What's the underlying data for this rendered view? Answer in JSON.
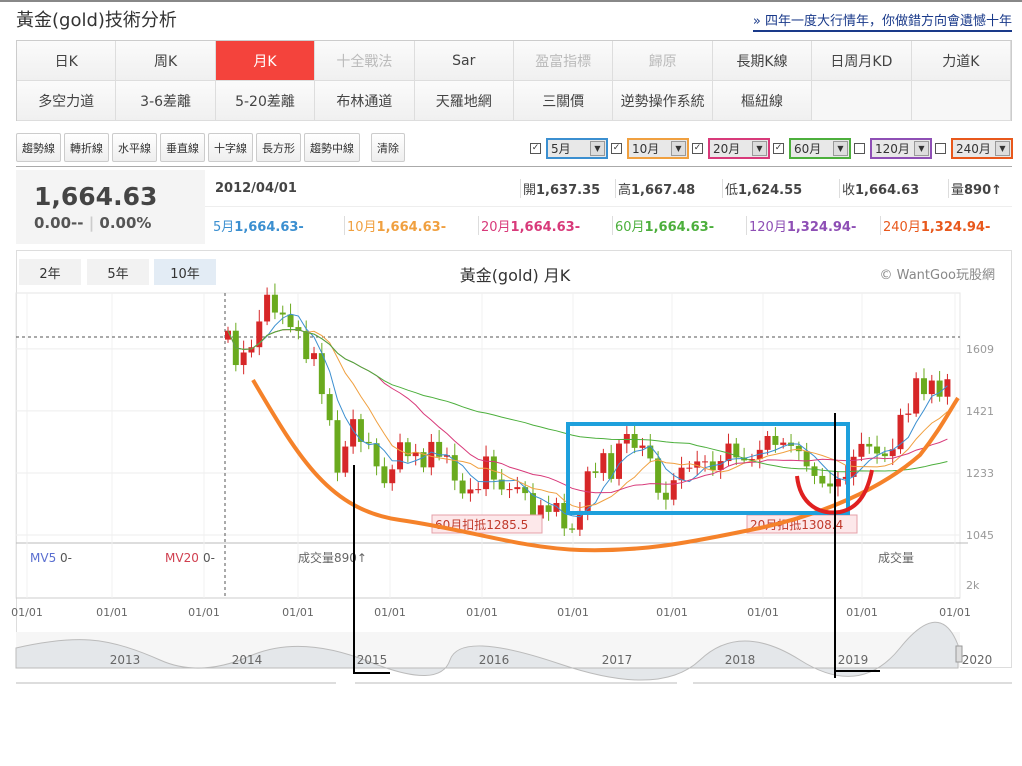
{
  "header": {
    "title": "黃金(gold)技術分析",
    "promo_link": "» 四年一度大行情年，你做錯方向會遺憾十年"
  },
  "period_buttons": [
    {
      "label": "日K",
      "state": "normal"
    },
    {
      "label": "周K",
      "state": "normal"
    },
    {
      "label": "月K",
      "state": "active"
    },
    {
      "label": "十全戰法",
      "state": "disabled"
    },
    {
      "label": "Sar",
      "state": "normal"
    },
    {
      "label": "盈富指標",
      "state": "disabled"
    },
    {
      "label": "歸原",
      "state": "disabled"
    },
    {
      "label": "長期K線",
      "state": "normal"
    },
    {
      "label": "日周月KD",
      "state": "normal"
    },
    {
      "label": "力道K",
      "state": "normal"
    },
    {
      "label": "多空力道",
      "state": "normal"
    },
    {
      "label": "3-6差離",
      "state": "normal"
    },
    {
      "label": "5-20差離",
      "state": "normal"
    },
    {
      "label": "布林通道",
      "state": "normal"
    },
    {
      "label": "天羅地網",
      "state": "normal"
    },
    {
      "label": "三關價",
      "state": "normal"
    },
    {
      "label": "逆勢操作系統",
      "state": "normal"
    },
    {
      "label": "樞紐線",
      "state": "normal"
    }
  ],
  "draw_tools": [
    "趨勢線",
    "轉折線",
    "水平線",
    "垂直線",
    "十字線",
    "長方形",
    "趨勢中線"
  ],
  "clear_label": "清除",
  "ma_selectors": [
    {
      "value": "5月",
      "checked": true,
      "color": "#3b8fd0"
    },
    {
      "value": "10月",
      "checked": true,
      "color": "#f0a040"
    },
    {
      "value": "20月",
      "checked": true,
      "color": "#d83a7a"
    },
    {
      "value": "60月",
      "checked": true,
      "color": "#4caf3c"
    },
    {
      "value": "120月",
      "checked": false,
      "color": "#8e4fb5"
    },
    {
      "value": "240月",
      "checked": false,
      "color": "#e8581c"
    }
  ],
  "quote": {
    "price": "1,664.63",
    "change": "0.00--",
    "change_pct": "0.00%",
    "date": "2012/04/01",
    "fields": [
      {
        "label": "開",
        "value": "1,637.35"
      },
      {
        "label": "高",
        "value": "1,667.48"
      },
      {
        "label": "低",
        "value": "1,624.55"
      },
      {
        "label": "收",
        "value": "1,664.63"
      },
      {
        "label": "量",
        "value": "890↑"
      }
    ],
    "mas": [
      {
        "label": "5月",
        "value": "1,664.63-",
        "color": "#3b8fd0"
      },
      {
        "label": "10月",
        "value": "1,664.63-",
        "color": "#f0a040"
      },
      {
        "label": "20月",
        "value": "1,664.63-",
        "color": "#d83a7a"
      },
      {
        "label": "60月",
        "value": "1,664.63-",
        "color": "#4caf3c"
      },
      {
        "label": "120月",
        "value": "1,324.94-",
        "color": "#8e4fb5"
      },
      {
        "label": "240月",
        "value": "1,324.94-",
        "color": "#e8581c"
      }
    ]
  },
  "chart": {
    "ranges": [
      {
        "label": "2年",
        "active": false
      },
      {
        "label": "5年",
        "active": false
      },
      {
        "label": "10年",
        "active": true
      }
    ],
    "title": "黃金(gold) 月K",
    "copyright": "© WantGoo玩股網",
    "y_ticks": [
      "1609",
      "1421",
      "1233",
      "1045"
    ],
    "vol_tick": "2k",
    "annotations": {
      "ma60_deduct": "60月扣抵1285.5",
      "ma20_deduct": "20月扣抵1308.4"
    },
    "vol_labels": {
      "mv5": "MV5",
      "mv5_val": "0-",
      "mv20": "MV20",
      "mv20_val": "0-",
      "volume": "成交量890↑",
      "volume_right": "成交量"
    },
    "x_ticks": [
      "01/01",
      "01/01",
      "01/01",
      "01/01",
      "01/01",
      "01/01",
      "01/01",
      "01/01",
      "01/01",
      "01/01",
      "01/01"
    ],
    "nav_years": [
      "2013",
      "2014",
      "2015",
      "2016",
      "2017",
      "2018",
      "2019",
      "2020"
    ]
  },
  "chart_data": {
    "type": "candlestick",
    "start": "2012-04",
    "interval": "month",
    "ylim": [
      1000,
      1800
    ],
    "close": [
      1664,
      1560,
      1598,
      1614,
      1692,
      1773,
      1719,
      1713,
      1675,
      1663,
      1578,
      1596,
      1472,
      1393,
      1234,
      1313,
      1396,
      1327,
      1323,
      1253,
      1202,
      1244,
      1326,
      1284,
      1296,
      1250,
      1327,
      1282,
      1287,
      1210,
      1171,
      1183,
      1184,
      1283,
      1213,
      1183,
      1184,
      1190,
      1172,
      1095,
      1135,
      1115,
      1142,
      1065,
      1061,
      1118,
      1238,
      1233,
      1293,
      1215,
      1322,
      1351,
      1309,
      1316,
      1277,
      1173,
      1152,
      1211,
      1249,
      1249,
      1268,
      1268,
      1242,
      1269,
      1322,
      1280,
      1271,
      1275,
      1303,
      1345,
      1318,
      1325,
      1315,
      1299,
      1253,
      1224,
      1201,
      1192,
      1215,
      1221,
      1282,
      1321,
      1313,
      1292,
      1284,
      1305,
      1409,
      1413,
      1520,
      1472,
      1513,
      1464,
      1517
    ]
  }
}
